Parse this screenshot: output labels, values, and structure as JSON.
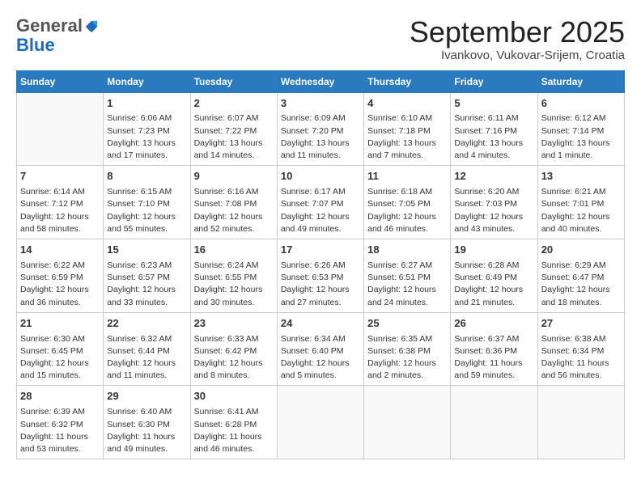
{
  "logo": {
    "general": "General",
    "blue": "Blue"
  },
  "title": "September 2025",
  "location": "Ivankovo, Vukovar-Srijem, Croatia",
  "weekdays": [
    "Sunday",
    "Monday",
    "Tuesday",
    "Wednesday",
    "Thursday",
    "Friday",
    "Saturday"
  ],
  "weeks": [
    [
      {
        "day": "",
        "info": ""
      },
      {
        "day": "1",
        "info": "Sunrise: 6:06 AM\nSunset: 7:23 PM\nDaylight: 13 hours\nand 17 minutes."
      },
      {
        "day": "2",
        "info": "Sunrise: 6:07 AM\nSunset: 7:22 PM\nDaylight: 13 hours\nand 14 minutes."
      },
      {
        "day": "3",
        "info": "Sunrise: 6:09 AM\nSunset: 7:20 PM\nDaylight: 13 hours\nand 11 minutes."
      },
      {
        "day": "4",
        "info": "Sunrise: 6:10 AM\nSunset: 7:18 PM\nDaylight: 13 hours\nand 7 minutes."
      },
      {
        "day": "5",
        "info": "Sunrise: 6:11 AM\nSunset: 7:16 PM\nDaylight: 13 hours\nand 4 minutes."
      },
      {
        "day": "6",
        "info": "Sunrise: 6:12 AM\nSunset: 7:14 PM\nDaylight: 13 hours\nand 1 minute."
      }
    ],
    [
      {
        "day": "7",
        "info": "Sunrise: 6:14 AM\nSunset: 7:12 PM\nDaylight: 12 hours\nand 58 minutes."
      },
      {
        "day": "8",
        "info": "Sunrise: 6:15 AM\nSunset: 7:10 PM\nDaylight: 12 hours\nand 55 minutes."
      },
      {
        "day": "9",
        "info": "Sunrise: 6:16 AM\nSunset: 7:08 PM\nDaylight: 12 hours\nand 52 minutes."
      },
      {
        "day": "10",
        "info": "Sunrise: 6:17 AM\nSunset: 7:07 PM\nDaylight: 12 hours\nand 49 minutes."
      },
      {
        "day": "11",
        "info": "Sunrise: 6:18 AM\nSunset: 7:05 PM\nDaylight: 12 hours\nand 46 minutes."
      },
      {
        "day": "12",
        "info": "Sunrise: 6:20 AM\nSunset: 7:03 PM\nDaylight: 12 hours\nand 43 minutes."
      },
      {
        "day": "13",
        "info": "Sunrise: 6:21 AM\nSunset: 7:01 PM\nDaylight: 12 hours\nand 40 minutes."
      }
    ],
    [
      {
        "day": "14",
        "info": "Sunrise: 6:22 AM\nSunset: 6:59 PM\nDaylight: 12 hours\nand 36 minutes."
      },
      {
        "day": "15",
        "info": "Sunrise: 6:23 AM\nSunset: 6:57 PM\nDaylight: 12 hours\nand 33 minutes."
      },
      {
        "day": "16",
        "info": "Sunrise: 6:24 AM\nSunset: 6:55 PM\nDaylight: 12 hours\nand 30 minutes."
      },
      {
        "day": "17",
        "info": "Sunrise: 6:26 AM\nSunset: 6:53 PM\nDaylight: 12 hours\nand 27 minutes."
      },
      {
        "day": "18",
        "info": "Sunrise: 6:27 AM\nSunset: 6:51 PM\nDaylight: 12 hours\nand 24 minutes."
      },
      {
        "day": "19",
        "info": "Sunrise: 6:28 AM\nSunset: 6:49 PM\nDaylight: 12 hours\nand 21 minutes."
      },
      {
        "day": "20",
        "info": "Sunrise: 6:29 AM\nSunset: 6:47 PM\nDaylight: 12 hours\nand 18 minutes."
      }
    ],
    [
      {
        "day": "21",
        "info": "Sunrise: 6:30 AM\nSunset: 6:45 PM\nDaylight: 12 hours\nand 15 minutes."
      },
      {
        "day": "22",
        "info": "Sunrise: 6:32 AM\nSunset: 6:44 PM\nDaylight: 12 hours\nand 11 minutes."
      },
      {
        "day": "23",
        "info": "Sunrise: 6:33 AM\nSunset: 6:42 PM\nDaylight: 12 hours\nand 8 minutes."
      },
      {
        "day": "24",
        "info": "Sunrise: 6:34 AM\nSunset: 6:40 PM\nDaylight: 12 hours\nand 5 minutes."
      },
      {
        "day": "25",
        "info": "Sunrise: 6:35 AM\nSunset: 6:38 PM\nDaylight: 12 hours\nand 2 minutes."
      },
      {
        "day": "26",
        "info": "Sunrise: 6:37 AM\nSunset: 6:36 PM\nDaylight: 11 hours\nand 59 minutes."
      },
      {
        "day": "27",
        "info": "Sunrise: 6:38 AM\nSunset: 6:34 PM\nDaylight: 11 hours\nand 56 minutes."
      }
    ],
    [
      {
        "day": "28",
        "info": "Sunrise: 6:39 AM\nSunset: 6:32 PM\nDaylight: 11 hours\nand 53 minutes."
      },
      {
        "day": "29",
        "info": "Sunrise: 6:40 AM\nSunset: 6:30 PM\nDaylight: 11 hours\nand 49 minutes."
      },
      {
        "day": "30",
        "info": "Sunrise: 6:41 AM\nSunset: 6:28 PM\nDaylight: 11 hours\nand 46 minutes."
      },
      {
        "day": "",
        "info": ""
      },
      {
        "day": "",
        "info": ""
      },
      {
        "day": "",
        "info": ""
      },
      {
        "day": "",
        "info": ""
      }
    ]
  ]
}
